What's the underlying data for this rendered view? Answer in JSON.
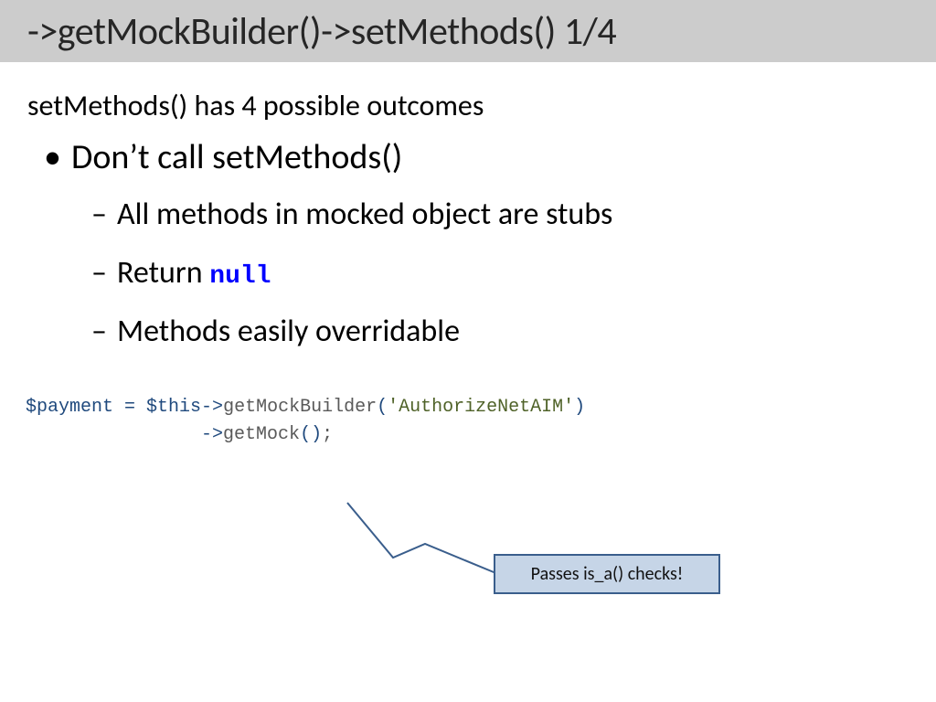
{
  "title": "->getMockBuilder()->setMethods() 1/4",
  "intro": "setMethods() has 4 possible outcomes",
  "bullet1": "Don’t call setMethods()",
  "sub1": "All methods in mocked object are stubs",
  "sub2_prefix": "Return ",
  "sub2_null": "null",
  "sub3": "Methods easily overridable",
  "code": {
    "var": "$payment",
    "eq": " = ",
    "this": "$this",
    "arrow": "->",
    "fn1": "getMockBuilder",
    "open": "(",
    "str": "'AuthorizeNetAIM'",
    "close": ")",
    "indent": "                ",
    "fn2": "getMock",
    "empty": "()",
    "semi": ";"
  },
  "callout": "Passes is_a() checks!"
}
